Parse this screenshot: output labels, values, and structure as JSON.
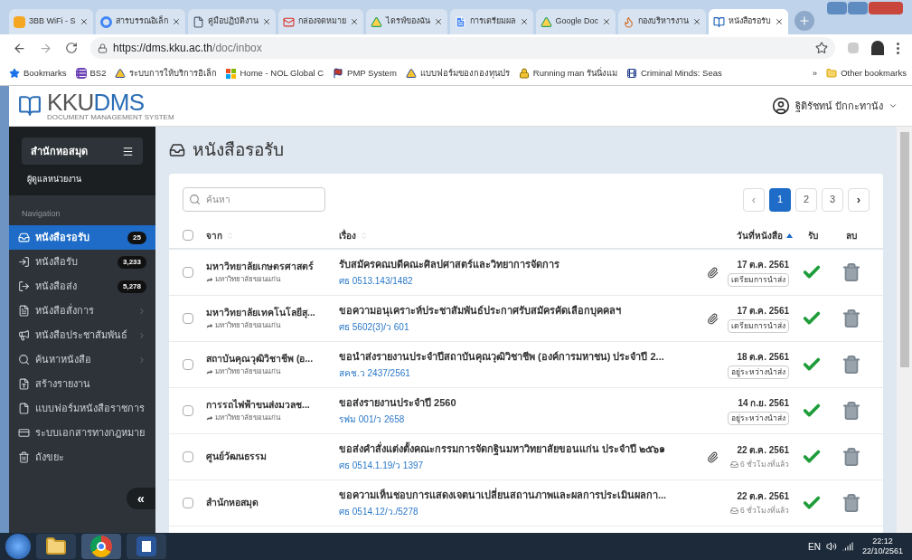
{
  "browser": {
    "tabs": [
      {
        "title": "3BB WiFi - S",
        "selected": false
      },
      {
        "title": "สารบรรณอิเล็ก",
        "selected": false
      },
      {
        "title": "คู่มือปฏิบัติงาน",
        "selected": false
      },
      {
        "title": "กล่องจดหมาย",
        "selected": false
      },
      {
        "title": "ไดรฟ์ของฉัน",
        "selected": false
      },
      {
        "title": "การเตรียมผล",
        "selected": false
      },
      {
        "title": "Google Doc",
        "selected": false
      },
      {
        "title": "กองบริหารงาน",
        "selected": false
      },
      {
        "title": "หนังสือรอรับ",
        "selected": true
      }
    ],
    "url_host": "https://dms.kku.ac.th",
    "url_path": "/doc/inbox",
    "bookmarks": [
      "Bookmarks",
      "BS2",
      "ระบบการให้บริการอิเล็ก",
      "Home - NOL Global C",
      "PMP System",
      "แบบฟอร์มของกองทุนปร",
      "Running man รันนิ่งแม",
      "Criminal Minds: Seas"
    ],
    "more": "»",
    "other_bookmarks": "Other bookmarks"
  },
  "app": {
    "logo_main": "KKU",
    "logo_accent": "DMS",
    "logo_sub": "DOCUMENT MANAGEMENT SYSTEM",
    "user": "ฐิติรัชทน์ ปักกะทานัง"
  },
  "sidebar": {
    "unit": "สำนักหอสมุด",
    "role": "ผู้ดูแลหน่วยงาน",
    "section": "Navigation",
    "collapse": "«",
    "items": [
      {
        "label": "หนังสือรอรับ",
        "count": "25",
        "selected": true,
        "has_children": false
      },
      {
        "label": "หนังสือรับ",
        "count": "3,233",
        "selected": false,
        "has_children": false
      },
      {
        "label": "หนังสือส่ง",
        "count": "5,278",
        "selected": false,
        "has_children": false
      },
      {
        "label": "หนังสือสั่งการ",
        "selected": false,
        "has_children": true
      },
      {
        "label": "หนังสือประชาสัมพันธ์",
        "selected": false,
        "has_children": true
      },
      {
        "label": "ค้นหาหนังสือ",
        "selected": false,
        "has_children": true
      },
      {
        "label": "สร้างรายงาน",
        "selected": false,
        "has_children": false
      },
      {
        "label": "แบบฟอร์มหนังสือราชการ",
        "selected": false,
        "has_children": false
      },
      {
        "label": "ระบบเอกสารทางกฎหมาย",
        "selected": false,
        "has_children": false
      },
      {
        "label": "ถังขยะ",
        "selected": false,
        "has_children": false
      }
    ]
  },
  "page": {
    "title": "หนังสือรอรับ",
    "search": {
      "placeholder": "ค้นหา"
    },
    "pagination": {
      "prev": "‹",
      "next": "›",
      "pages": [
        {
          "label": "1",
          "selected": true
        },
        {
          "label": "2",
          "selected": false
        },
        {
          "label": "3",
          "selected": false
        }
      ]
    },
    "table": {
      "select_all_checked": false,
      "columns": [
        "จาก",
        "เรื่อง",
        "วันที่หนังสือ",
        "รับ",
        "ลบ"
      ],
      "rows": [
        {
          "from": "มหาวิทยาลัยเกษตรศาสตร์",
          "via": "มหาวิทยาลัยขอนแก่น",
          "subject": "รับสมัครคณบดีคณะศิลปศาสตร์และวิทยาการจัดการ",
          "ref": "ศธ 0513.143/1482",
          "attachment": true,
          "date": "17 ต.ค. 2561",
          "kind": "badge",
          "status": "เตรียมการนำส่ง",
          "checked": false
        },
        {
          "from": "มหาวิทยาลัยเทคโนโลยีสุ...",
          "via": "มหาวิทยาลัยขอนแก่น",
          "subject": "ขอความอนุเคราะห์ประชาสัมพันธ์ประกาศรับสมัครคัดเลือกบุคคลฯ",
          "ref": "ศธ 5602(3)/ว 601",
          "attachment": true,
          "date": "17 ต.ค. 2561",
          "kind": "badge",
          "status": "เตรียมการนำส่ง",
          "checked": false
        },
        {
          "from": "สถาบันคุณวุฒิวิชาชีพ (อ...",
          "via": "มหาวิทยาลัยขอนแก่น",
          "subject": "ขอนำส่งรายงานประจำปีสถาบันคุณวุฒิวิชาชีพ (องค์การมหาชน) ประจำปี 2...",
          "ref": "สคช.ว 2437/2561",
          "attachment": false,
          "date": "18 ต.ค. 2561",
          "kind": "badge",
          "status": "อยู่ระหว่างนำส่ง",
          "checked": false
        },
        {
          "from": "การรถไฟฟ้าขนส่งมวลช...",
          "via": "มหาวิทยาลัยขอนแก่น",
          "subject": "ขอส่งรายงานประจำปี 2560",
          "ref": "รฟม 001/ว 2658",
          "attachment": false,
          "date": "14 ก.ย. 2561",
          "kind": "badge",
          "status": "อยู่ระหว่างนำส่ง",
          "checked": false
        },
        {
          "from": "ศูนย์วัฒนธรรม",
          "subject": "ขอส่งคำสั่งแต่งตั้งคณะกรรมการจัดกฐินมหาวิทยาลัยขอนแก่น ประจำปี ๒๕๖๑",
          "ref": "ศธ 0514.1.19/ว 1397",
          "attachment": true,
          "date": "22 ต.ค. 2561",
          "kind": "time",
          "status": "6 ชั่วโมงที่แล้ว",
          "checked": false
        },
        {
          "from": "สำนักหอสมุด",
          "subject": "ขอความเห็นชอบการแสดงเจตนาเปลี่ยนสถานภาพและผลการประเมินผลกา...",
          "ref": "ศธ 0514.12/ว./5278",
          "attachment": false,
          "date": "22 ต.ค. 2561",
          "kind": "time",
          "status": "6 ชั่วโมงที่แล้ว",
          "checked": false
        }
      ]
    }
  },
  "taskbar": {
    "apps": [
      {
        "selected": false
      },
      {
        "selected": true
      },
      {
        "selected": false
      }
    ],
    "lang": "EN",
    "time": "22:12",
    "date": "22/10/2561"
  }
}
